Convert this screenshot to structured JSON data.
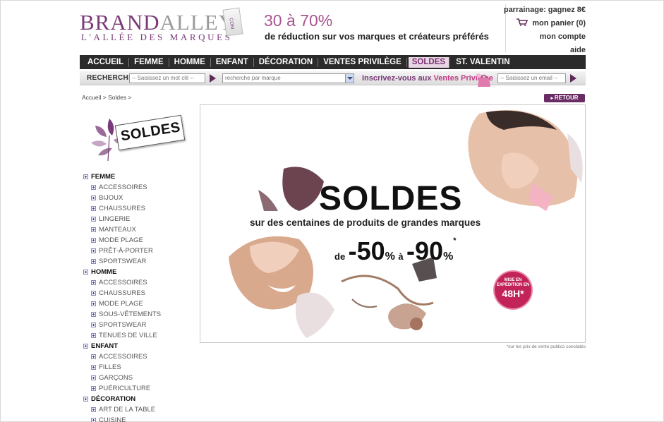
{
  "logo": {
    "brand_part1": "BRAND",
    "brand_part2": "ALLEY",
    "tagline": "L'ALLÉE DES MARQUES",
    "suffix": "COM"
  },
  "promo": {
    "percent": "30 à 70%",
    "text": "de réduction sur vos marques et créateurs préférés"
  },
  "top_links": {
    "sponsorship": "parrainage: gagnez 8€",
    "cart": "mon panier (0)",
    "account": "mon compte",
    "help": "aide"
  },
  "nav": {
    "items": [
      "ACCUEIL",
      "FEMME",
      "HOMME",
      "ENFANT",
      "DÉCORATION",
      "VENTES PRIVILÈGE",
      "SOLDES",
      "ST. VALENTIN"
    ],
    "active_index": 6
  },
  "search": {
    "label": "RECHERCHE",
    "keyword_placeholder": "-- Saisissez un mot clé --",
    "brand_select": "recherche par marque",
    "signup_text_prefix": "Inscrivez-vous aux ",
    "signup_text_highlight": "Ventes Privilège",
    "email_placeholder": "-- Saisissez un email --"
  },
  "breadcrumb": {
    "home": "Accueil",
    "sep": ">",
    "current": "Soldes",
    "sep2": ">"
  },
  "retour_label": "RETOUR",
  "badge_text": "SOLDES",
  "sidebar": {
    "categories": [
      {
        "label": "FEMME",
        "items": [
          "ACCESSOIRES",
          "BIJOUX",
          "CHAUSSURES",
          "LINGERIE",
          "MANTEAUX",
          "MODE PLAGE",
          "PRÊT-À-PORTER",
          "SPORTSWEAR"
        ]
      },
      {
        "label": "HOMME",
        "items": [
          "ACCESSOIRES",
          "CHAUSSURES",
          "MODE PLAGE",
          "SOUS-VÊTEMENTS",
          "SPORTSWEAR",
          "TENUES DE VILLE"
        ]
      },
      {
        "label": "ENFANT",
        "items": [
          "ACCESSOIRES",
          "FILLES",
          "GARÇONS",
          "PUÉRICULTURE"
        ]
      },
      {
        "label": "DÉCORATION",
        "items": [
          "ART DE LA TABLE",
          "CUISINE"
        ]
      }
    ]
  },
  "banner": {
    "title": "SOLDES",
    "subtitle": "sur des centaines de produits de grandes marques",
    "from": "de",
    "minus1": "-50",
    "pct1": "%",
    "to": "à",
    "minus2": "-90",
    "pct2": "%",
    "star": "*",
    "stamp_line1": "MISE EN",
    "stamp_line2": "EXPÉDITION EN",
    "stamp_big": "48H",
    "stamp_star": "*"
  },
  "footnote": "*sur les prix de vente publics constatés",
  "colors": {
    "brand": "#7a3a78",
    "accent": "#c13b86",
    "nav_bg": "#2b2b2b",
    "stamp": "#c2245a"
  }
}
